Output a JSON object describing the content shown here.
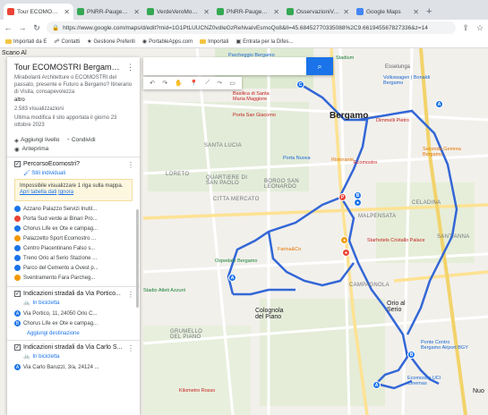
{
  "tabs": [
    {
      "title": "Tour ECOMOSTRI Be",
      "active": true,
      "color": "#ea4335"
    },
    {
      "title": "PNRR-PaugemPorta",
      "active": false,
      "color": "#34a853"
    },
    {
      "title": "VerdeVeroMonte&di",
      "active": false,
      "color": "#34a853"
    },
    {
      "title": "PNRR-PaugemPortal",
      "active": false,
      "color": "#34a853"
    },
    {
      "title": "OsservazioniVeiBCF",
      "active": false,
      "color": "#34a853"
    },
    {
      "title": "Google Maps",
      "active": false,
      "color": "#4285f4"
    }
  ],
  "tab_new": "+",
  "url": "https://www.google.com/maps/d/edit?mid=1G1PtLUUCNZ0vdIeGzReNvaIvEsmoQo8&ll=45.68452770335088%2C9.661945567827336&z=14",
  "bookmarks": [
    "Importati da E",
    "Contatti",
    "Gestione Preferiti",
    "PortableApps.com",
    "Importati",
    "Entrata per la Difes..."
  ],
  "panel": {
    "title": "Tour ECOMOSTRI Bergamo e Mir...",
    "description": "Mirabolanti Architetture o ECOMOSTRI del passato, presente e Futuro a Bergamo? Itinerario di Visita, consapevolezza",
    "altro": "altro",
    "views": "2.583 visualizzazioni",
    "last_modified": "Ultima modifica il sito apportata il giorno 23 ottobre 2023",
    "add_layer": "Aggiungi livello",
    "share": "Condividi",
    "preview": "Anteprima"
  },
  "layer1": {
    "title": "PercorsoEcomostri?",
    "styles": "Stili individuali",
    "warning": "Impossibile visualizzare 1 riga sulla mappa.",
    "warning_link1": "Apri tabella dati",
    "warning_link2": "Ignora",
    "items": [
      {
        "label": "Azzano Palazzo Servizi Inutil...",
        "color": "blue"
      },
      {
        "label": "Porta Sud verde ai Binari Pro...",
        "color": "red"
      },
      {
        "label": "Chorus Life ex Ote e campag...",
        "color": "blue"
      },
      {
        "label": "Palazzetto Sport Ecomostro ...",
        "color": "orange"
      },
      {
        "label": "Centro Piacentinano Falso s...",
        "color": "blue"
      },
      {
        "label": "Treno Orio al Serio Stazione ...",
        "color": "blue"
      },
      {
        "label": "Parco del Cemento a Ovest p...",
        "color": "blue"
      },
      {
        "label": "Sventramento Fara Parcheg...",
        "color": "orange"
      }
    ]
  },
  "layer2": {
    "title": "Indicazioni stradali da Via Portico...",
    "mode": "In bicicletta",
    "from": "Via Portico, 11, 24050 Orio C...",
    "to": "Chorus Life ex Ote e campag...",
    "add_destination": "Aggiungi destinazione"
  },
  "layer3": {
    "title": "Indicazioni stradali da Via Carlo S...",
    "mode": "In bicicletta",
    "from": "Via Carlo Baruzzi, 3/a, 24124 ..."
  },
  "map_labels": {
    "city": "Bergamo",
    "districts": [
      "SANTA LUCIA",
      "LORETO",
      "QUARTIERE DI SAN PAOLO",
      "BORGO SAN LEONARDO",
      "CITTA MERCATO",
      "MALPENSATA",
      "CELADINA",
      "CAMPAGNOLA",
      "GRUMELLO DEL PIANO",
      "SANT'ANNA"
    ],
    "towns": [
      "Colognola del Piano",
      "Orio al Serio",
      "Esselunga",
      "Scano Al",
      "Nuo"
    ],
    "pois": [
      "Basilica di Santa Maria Maggiore",
      "Porta San Giacomo",
      "Volkswagen | Bonaldi Bergamo",
      "Dimmelli Pietro",
      "Seconda Gemma Bergamo",
      "Stadium",
      "Parcheggio Bergamo 'Lorenzo Rota'",
      "Starhotels Cristallo Palace",
      "Farina&Co",
      "Ecomostro",
      "Porta Nuova",
      "Ospedale Bergamo",
      "Ristorante",
      "Kilometro Rosso",
      "Ecomostro UCI Cinemas",
      "Ponte Centro Bergamo Airport BGY",
      "Stadio Atleti Azzurri"
    ]
  },
  "colors": {
    "route": "#3367d6",
    "accent": "#1a73e8"
  }
}
